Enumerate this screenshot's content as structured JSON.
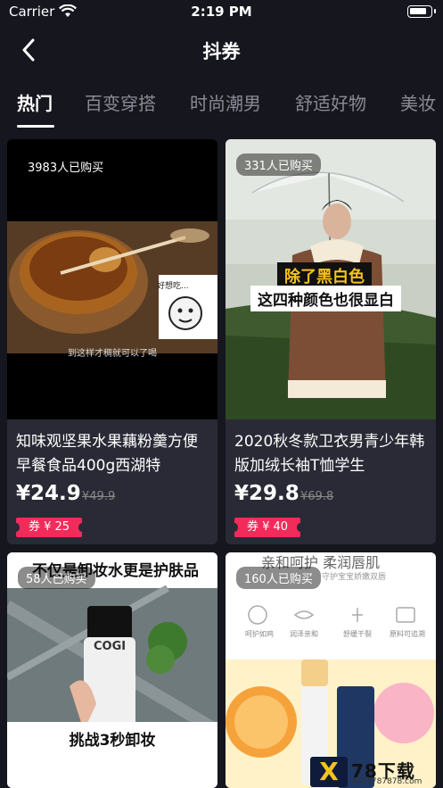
{
  "status_bar": {
    "carrier": "Carrier",
    "time": "2:19 PM"
  },
  "nav": {
    "title": "抖券"
  },
  "tabs": [
    {
      "label": "热门",
      "active": true
    },
    {
      "label": "百变穿搭"
    },
    {
      "label": "时尚潮男"
    },
    {
      "label": "舒适好物"
    },
    {
      "label": "美妆"
    }
  ],
  "products": [
    {
      "sold": "3983人已购买",
      "image_caption_1": "好想吃...",
      "image_caption_2": "到这样才稠就可以了喝",
      "title": "知味观坚果水果藕粉羹方便早餐食品400g西湖特",
      "price": "¥24.9",
      "original_price": "¥49.9",
      "coupon": "券 ¥ 25"
    },
    {
      "sold": "331人已购买",
      "image_caption_1": "除了黑白色",
      "image_caption_2": "这四种颜色也很显白",
      "title": "2020秋冬款卫衣男青少年韩版加绒长袖T恤学生",
      "price": "¥29.8",
      "original_price": "¥69.8",
      "coupon": "券 ¥ 40"
    },
    {
      "sold": "58人已购买",
      "image_caption_1": "不仅是卸妆水更是护肤品",
      "image_caption_2": "挑战3秒卸妆",
      "brand": "COGI"
    },
    {
      "sold": "160人已购买",
      "image_caption_1": "亲和呵护 柔润唇肌",
      "image_caption_2": "守护宝宝娇嫩双唇",
      "icon_labels": [
        "呵护如鸡",
        "润泽亲和",
        "舒缓干裂",
        "原料可追溯"
      ]
    }
  ],
  "watermark": {
    "title": "78下载",
    "url": "4007787878.com"
  },
  "colors": {
    "background": "#16161f",
    "card": "#2a2a36",
    "coupon": "#f12c5b"
  }
}
